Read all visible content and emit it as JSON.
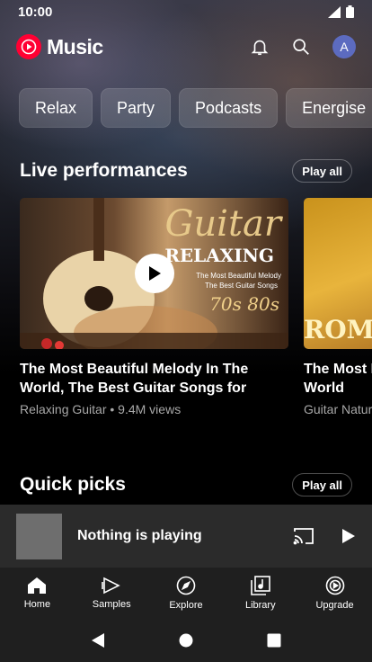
{
  "status_bar": {
    "time": "10:00"
  },
  "header": {
    "app_name": "Music",
    "avatar_initial": "A"
  },
  "chips": [
    "Relax",
    "Party",
    "Podcasts",
    "Energise"
  ],
  "live_section": {
    "title": "Live performances",
    "play_all": "Play all",
    "cards": [
      {
        "title": "The Most Beautiful Melody In The World, The Best Guitar Songs for You,...",
        "meta": "Relaxing Guitar • 9.4M views",
        "thumb_heading": "Guitar",
        "thumb_sub": "RELAXING",
        "thumb_line1": "The Most Beautiful Melody",
        "thumb_line2": "The Best Guitar Songs",
        "thumb_years": "70s 80s"
      },
      {
        "title": "The Most Beautiful Melody In The World",
        "meta": "Guitar Nature",
        "thumb_text": "ROMA"
      }
    ]
  },
  "quick_section": {
    "title": "Quick picks",
    "play_all": "Play all"
  },
  "mini_player": {
    "title": "Nothing is playing"
  },
  "bottom_nav": [
    "Home",
    "Samples",
    "Explore",
    "Library",
    "Upgrade"
  ],
  "colors": {
    "brand": "#ff0033",
    "avatar": "#5c6bc0"
  }
}
